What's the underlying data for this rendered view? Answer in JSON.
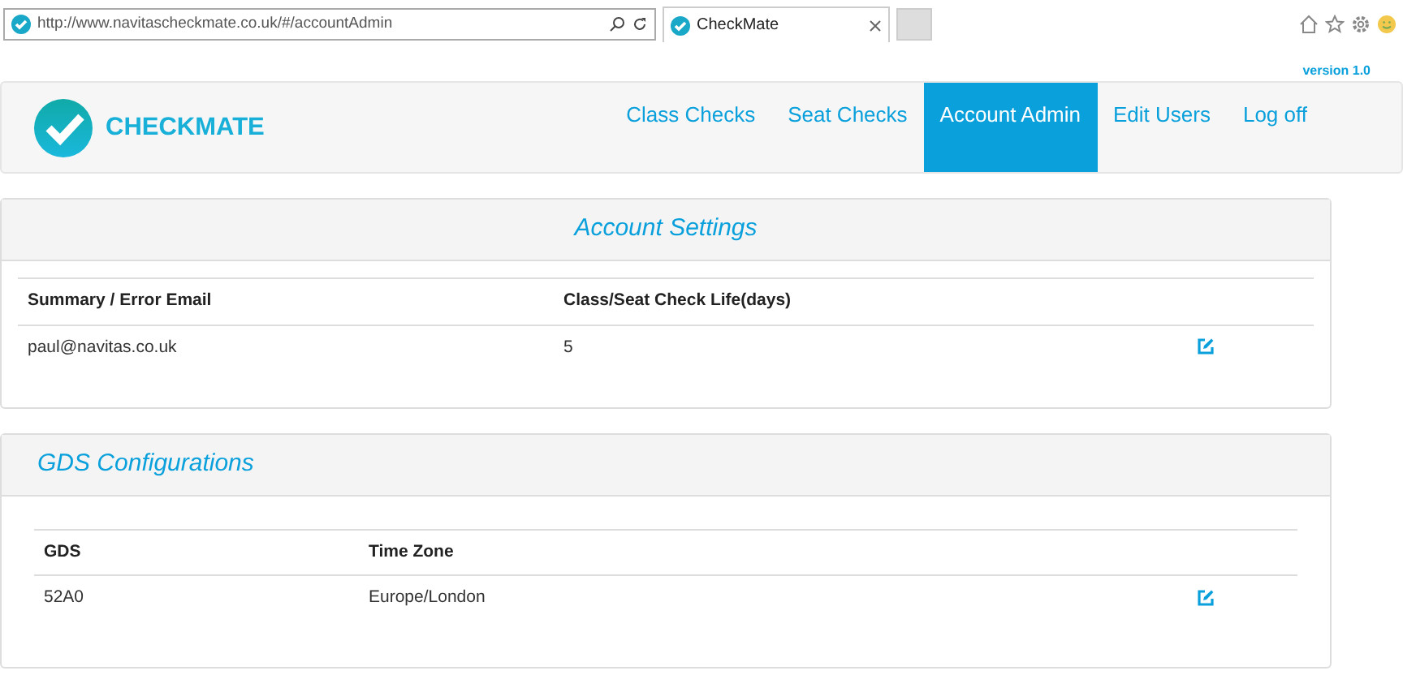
{
  "browser": {
    "address": "http://www.navitascheckmate.co.uk/#/accountAdmin",
    "tab_title": "CheckMate"
  },
  "version": "version 1.0",
  "brand": "CHECKMATE",
  "nav": [
    {
      "label": "Class Checks",
      "selected": false
    },
    {
      "label": "Seat Checks",
      "selected": false
    },
    {
      "label": "Account Admin",
      "selected": true
    },
    {
      "label": "Edit Users",
      "selected": false
    },
    {
      "label": "Log off",
      "selected": false
    }
  ],
  "panels": [
    {
      "title": "Account Settings",
      "title_centered": true,
      "columns": [
        "Summary / Error Email",
        "Class/Seat Check Life(days)"
      ],
      "rows": [
        [
          "paul@navitas.co.uk",
          "5"
        ]
      ]
    },
    {
      "title": "GDS Configurations",
      "title_centered": false,
      "columns": [
        "GDS",
        "Time Zone"
      ],
      "rows": [
        [
          "52A0",
          "Europe/London"
        ]
      ]
    }
  ]
}
